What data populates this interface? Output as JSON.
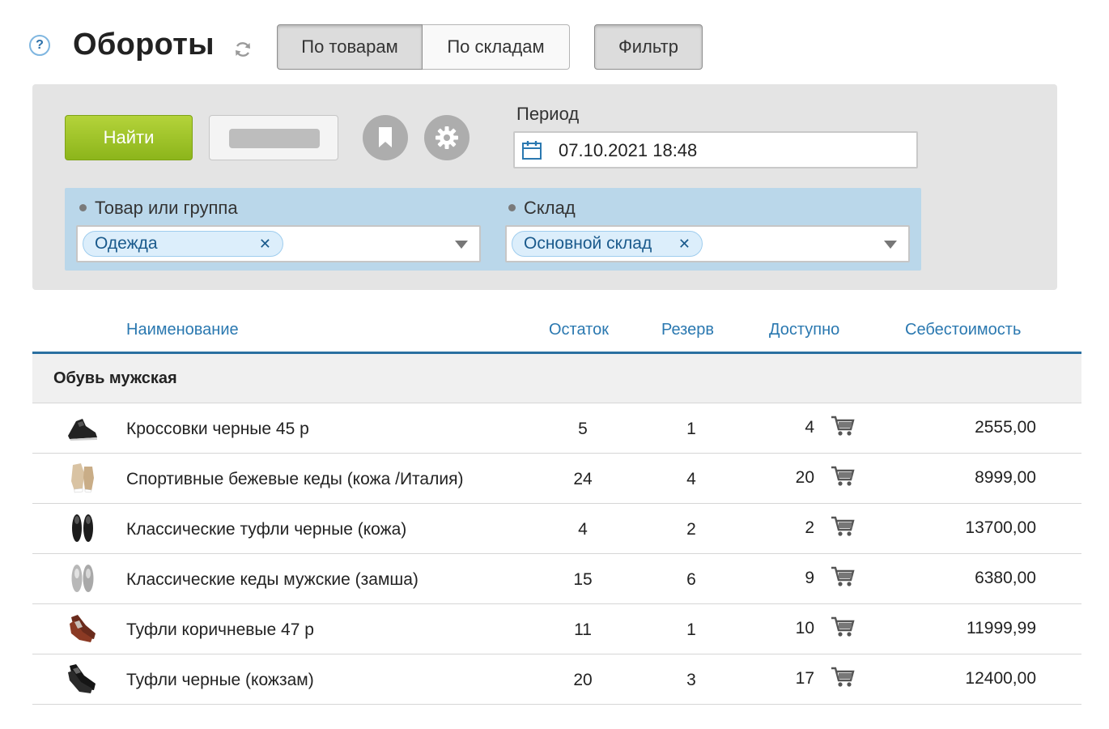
{
  "header": {
    "help_symbol": "?",
    "title": "Обороты",
    "tabs": [
      {
        "label": "По товарам",
        "active": true
      },
      {
        "label": "По складам",
        "active": false
      }
    ],
    "filter_label": "Фильтр"
  },
  "filter": {
    "find_label": "Найти",
    "period_label": "Период",
    "period_value": "07.10.2021 18:48",
    "goods_label": "Товар или группа",
    "goods_chip": "Одежда",
    "store_label": "Склад",
    "store_chip": "Основной склад",
    "chip_close": "✕"
  },
  "table": {
    "columns": [
      "Наименование",
      "Остаток",
      "Резерв",
      "Доступно",
      "Себестоимость"
    ],
    "group": "Обувь мужская",
    "rows": [
      {
        "name": "Кроссовки черные 45 р",
        "stock": "5",
        "reserve": "1",
        "available": "4",
        "cost": "2555,00"
      },
      {
        "name": "Спортивные бежевые кеды (кожа /Италия)",
        "stock": "24",
        "reserve": "4",
        "available": "20",
        "cost": "8999,00"
      },
      {
        "name": "Классические туфли черные (кожа)",
        "stock": "4",
        "reserve": "2",
        "available": "2",
        "cost": "13700,00"
      },
      {
        "name": "Классические кеды мужские (замша)",
        "stock": "15",
        "reserve": "6",
        "available": "9",
        "cost": "6380,00"
      },
      {
        "name": "Туфли коричневые 47 р",
        "stock": "11",
        "reserve": "1",
        "available": "10",
        "cost": "11999,99"
      },
      {
        "name": "Туфли черные (кожзам)",
        "stock": "20",
        "reserve": "3",
        "available": "17",
        "cost": "12400,00"
      }
    ]
  },
  "colors": {
    "accent_blue": "#2a78b0",
    "find_green": "#9cc52a",
    "panel_gray": "#e4e4e4",
    "criteria_blue": "#bad7ea"
  }
}
